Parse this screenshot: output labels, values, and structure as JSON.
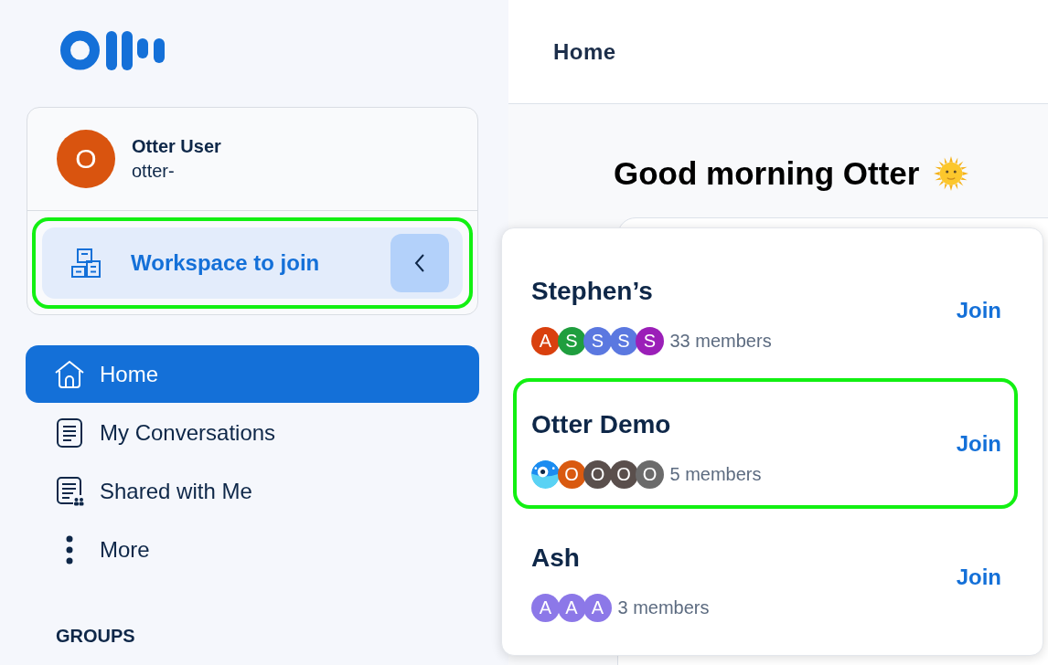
{
  "sidebar": {
    "profile": {
      "avatar_letter": "O",
      "name": "Otter User",
      "username": "otter-"
    },
    "workspace_button": {
      "label": "Workspace to join",
      "expanded": true,
      "highlighted": true
    },
    "nav_items": [
      {
        "label": "Home",
        "selected": true
      },
      {
        "label": "My Conversations",
        "selected": false
      },
      {
        "label": "Shared with Me",
        "selected": false
      },
      {
        "label": "More",
        "selected": false
      }
    ],
    "section_heading": "GROUPS"
  },
  "header": {
    "title": "Home"
  },
  "greeting": "Good morning Otter",
  "workspace_menu": {
    "workspaces": [
      {
        "name": "Stephen’s",
        "members": "33 members",
        "join_label": "Join",
        "highlighted": false,
        "avatars": [
          {
            "kind": "letter",
            "letter": "A",
            "color": "#d9400e"
          },
          {
            "kind": "letter",
            "letter": "S",
            "color": "#1f9e3e"
          },
          {
            "kind": "letter",
            "letter": "S",
            "color": "#5b78e0"
          },
          {
            "kind": "letter",
            "letter": "S",
            "color": "#5b78e0"
          },
          {
            "kind": "letter",
            "letter": "S",
            "color": "#9b1fb8"
          }
        ]
      },
      {
        "name": "Otter Demo",
        "members": "5 members",
        "join_label": "Join",
        "highlighted": true,
        "avatars": [
          {
            "kind": "mascot"
          },
          {
            "kind": "letter",
            "letter": "O",
            "color": "#d95a10"
          },
          {
            "kind": "letter",
            "letter": "O",
            "color": "#5a4f4c"
          },
          {
            "kind": "letter",
            "letter": "O",
            "color": "#5a4f4c"
          },
          {
            "kind": "letter",
            "letter": "O",
            "color": "#6b6b6b"
          }
        ]
      },
      {
        "name": "Ash",
        "members": "3 members",
        "join_label": "Join",
        "highlighted": false,
        "avatars": [
          {
            "kind": "letter",
            "letter": "A",
            "color": "#8c78e8"
          },
          {
            "kind": "letter",
            "letter": "A",
            "color": "#8c78e8"
          },
          {
            "kind": "letter",
            "letter": "A",
            "color": "#8c78e8"
          }
        ]
      }
    ]
  }
}
